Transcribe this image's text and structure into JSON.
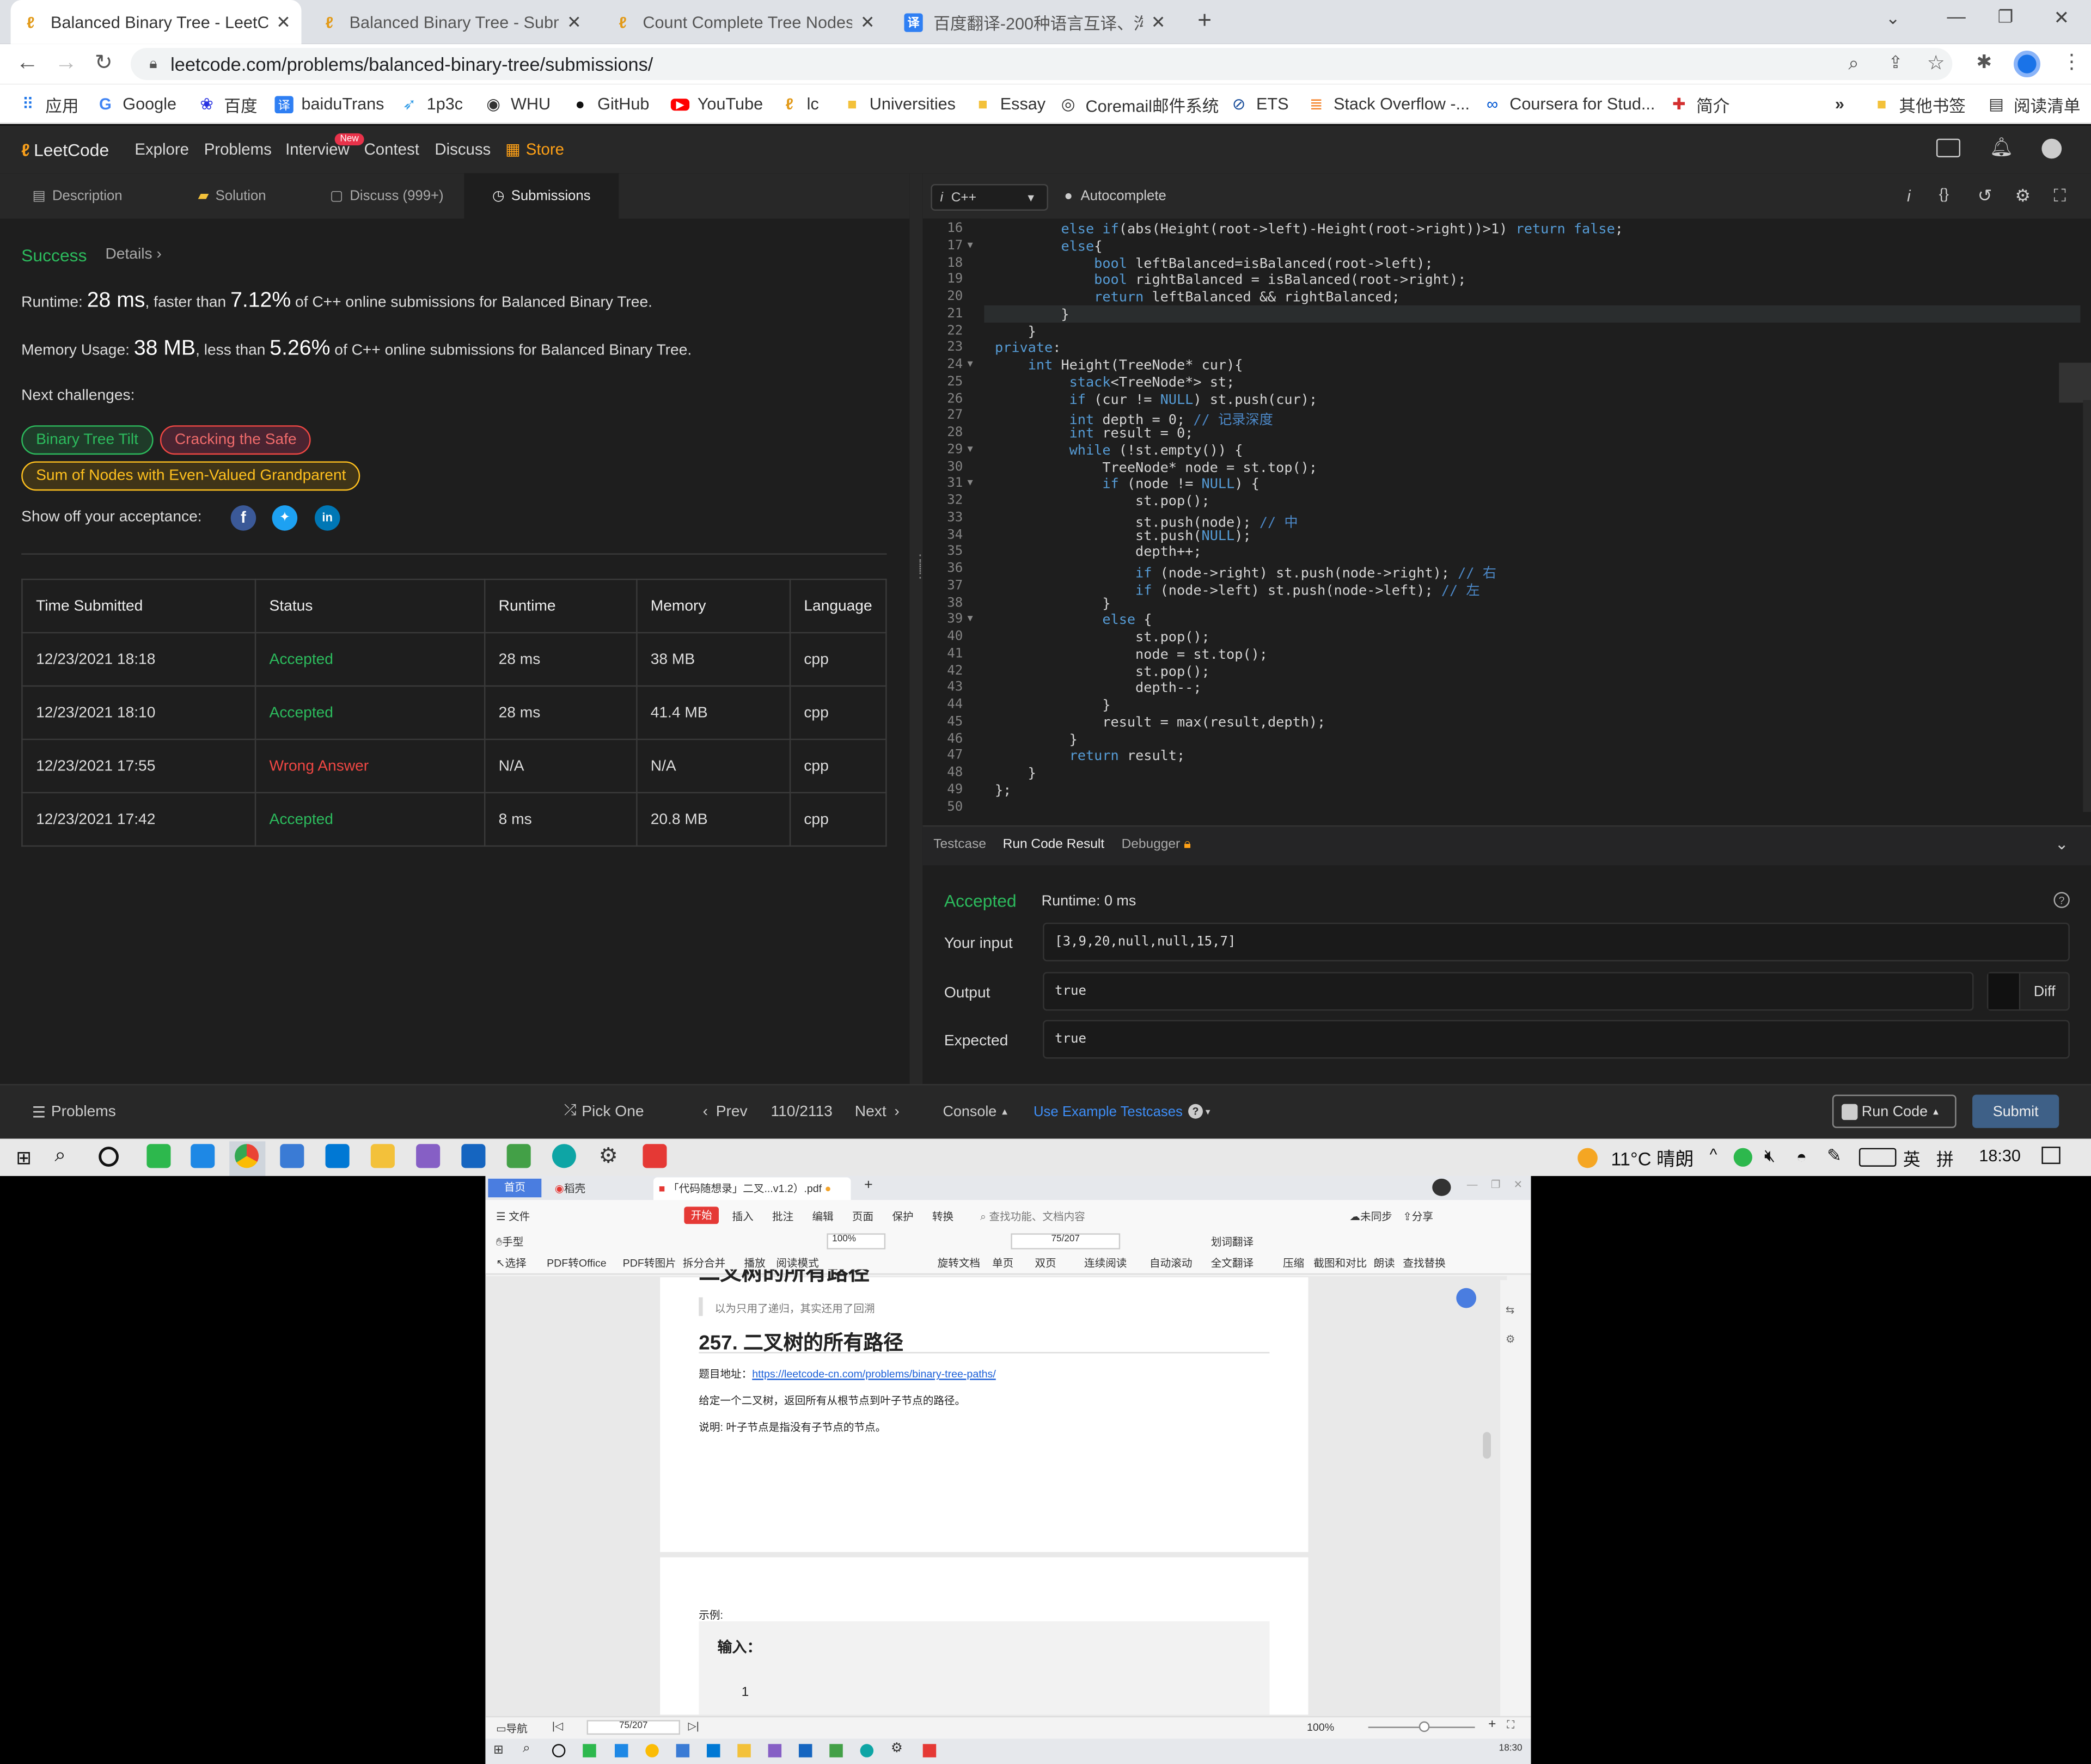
{
  "browser": {
    "tabs": [
      {
        "title": "Balanced Binary Tree - LeetCo",
        "icon": "leetcode-icon",
        "active": true
      },
      {
        "title": "Balanced Binary Tree - Submis",
        "icon": "leetcode-icon"
      },
      {
        "title": "Count Complete Tree Nodes -",
        "icon": "leetcode-icon"
      },
      {
        "title": "百度翻译-200种语言互译、沟通",
        "icon": "baidu-translate-icon"
      }
    ],
    "url": "leetcode.com/problems/balanced-binary-tree/submissions/",
    "bookmarks": [
      "应用",
      "Google",
      "百度",
      "baiduTrans",
      "1p3c",
      "WHU",
      "GitHub",
      "YouTube",
      "lc",
      "Universities",
      "Essay",
      "Coremail邮件系统",
      "ETS",
      "Stack Overflow -...",
      "Coursera for Stud...",
      "简介"
    ],
    "bookmarks_more": "»",
    "bookmarks_other": "其他书签",
    "reading_list": "阅读清单"
  },
  "lc_nav": {
    "logo": "LeetCode",
    "items": [
      "Explore",
      "Problems",
      "Interview",
      "Contest",
      "Discuss",
      "Store"
    ],
    "new_badge": "New"
  },
  "left_tabs": [
    "Description",
    "Solution",
    "Discuss (999+)",
    "Submissions"
  ],
  "result": {
    "status": "Success",
    "details": "Details",
    "runtime_label": "Runtime:",
    "runtime_value": "28 ms",
    "runtime_mid": ", faster than",
    "runtime_pct": "7.12%",
    "runtime_tail": "of C++ online submissions for Balanced Binary Tree.",
    "memory_label": "Memory Usage:",
    "memory_value": "38 MB",
    "memory_mid": ", less than",
    "memory_pct": "5.26%",
    "memory_tail": "of C++ online submissions for Balanced Binary Tree.",
    "next_label": "Next challenges:",
    "challenges": [
      "Binary Tree Tilt",
      "Cracking the Safe",
      "Sum of Nodes with Even-Valued Grandparent"
    ],
    "show_off": "Show off your acceptance:"
  },
  "submissions": {
    "headers": [
      "Time Submitted",
      "Status",
      "Runtime",
      "Memory",
      "Language"
    ],
    "rows": [
      [
        "12/23/2021 18:18",
        "Accepted",
        "28 ms",
        "38 MB",
        "cpp"
      ],
      [
        "12/23/2021 18:10",
        "Accepted",
        "28 ms",
        "41.4 MB",
        "cpp"
      ],
      [
        "12/23/2021 17:55",
        "Wrong Answer",
        "N/A",
        "N/A",
        "cpp"
      ],
      [
        "12/23/2021 17:42",
        "Accepted",
        "8 ms",
        "20.8 MB",
        "cpp"
      ]
    ]
  },
  "editor": {
    "language": "C++",
    "autocomplete": "Autocomplete",
    "lines": [
      {
        "n": "16",
        "t": "        else if(abs(Height(root->left)-Height(root->right))>1) return false;"
      },
      {
        "n": "17",
        "t": "        else{",
        "fold": true
      },
      {
        "n": "18",
        "t": "            bool leftBalanced=isBalanced(root->left);"
      },
      {
        "n": "19",
        "t": "            bool rightBalanced = isBalanced(root->right);"
      },
      {
        "n": "20",
        "t": "            return leftBalanced && rightBalanced;"
      },
      {
        "n": "21",
        "t": "        }"
      },
      {
        "n": "22",
        "t": "    }"
      },
      {
        "n": "23",
        "t": "private:"
      },
      {
        "n": "24",
        "t": "    int Height(TreeNode* cur){",
        "fold": true
      },
      {
        "n": "25",
        "t": "         stack<TreeNode*> st;"
      },
      {
        "n": "26",
        "t": "         if (cur != NULL) st.push(cur);"
      },
      {
        "n": "27",
        "t": "         int depth = 0; // 记录深度"
      },
      {
        "n": "28",
        "t": "         int result = 0;"
      },
      {
        "n": "29",
        "t": "         while (!st.empty()) {",
        "fold": true
      },
      {
        "n": "30",
        "t": "             TreeNode* node = st.top();"
      },
      {
        "n": "31",
        "t": "             if (node != NULL) {",
        "fold": true
      },
      {
        "n": "32",
        "t": "                 st.pop();"
      },
      {
        "n": "33",
        "t": "                 st.push(node); // 中"
      },
      {
        "n": "34",
        "t": "                 st.push(NULL);"
      },
      {
        "n": "35",
        "t": "                 depth++;"
      },
      {
        "n": "36",
        "t": "                 if (node->right) st.push(node->right); // 右"
      },
      {
        "n": "37",
        "t": "                 if (node->left) st.push(node->left); // 左"
      },
      {
        "n": "38",
        "t": "             }"
      },
      {
        "n": "39",
        "t": "             else {",
        "fold": true
      },
      {
        "n": "40",
        "t": "                 st.pop();"
      },
      {
        "n": "41",
        "t": "                 node = st.top();"
      },
      {
        "n": "42",
        "t": "                 st.pop();"
      },
      {
        "n": "43",
        "t": "                 depth--;"
      },
      {
        "n": "44",
        "t": "             }"
      },
      {
        "n": "45",
        "t": "             result = max(result,depth);"
      },
      {
        "n": "46",
        "t": "         }"
      },
      {
        "n": "47",
        "t": "         return result;"
      },
      {
        "n": "48",
        "t": "    }"
      },
      {
        "n": "49",
        "t": "};"
      },
      {
        "n": "50",
        "t": ""
      }
    ]
  },
  "run_result": {
    "tabs": [
      "Testcase",
      "Run Code Result",
      "Debugger"
    ],
    "status": "Accepted",
    "runtime": "Runtime: 0 ms",
    "input_label": "Your input",
    "input": "[3,9,20,null,null,15,7]",
    "output_label": "Output",
    "output": "true",
    "diff": "Diff",
    "expected_label": "Expected",
    "expected": "true"
  },
  "bottom_bar": {
    "problems": "Problems",
    "pick_one": "Pick One",
    "prev": "Prev",
    "page": "110/2113",
    "next": "Next",
    "console": "Console",
    "use_example": "Use Example Testcases",
    "run_code": "Run Code",
    "submit": "Submit"
  },
  "taskbar": {
    "weather": "11°C  晴朗",
    "ime": "英",
    "time": "18:30"
  },
  "wps": {
    "tabs": [
      "首页",
      "稻壳",
      "「代码随想录」二叉...v1.2）.pdf"
    ],
    "menu": [
      "文件",
      "开始",
      "插入",
      "批注",
      "编辑",
      "页面",
      "保护",
      "转换"
    ],
    "search": "查找功能、文档内容",
    "sync": "未同步",
    "share": "分享",
    "tools": [
      "手型",
      "选择",
      "PDF转Office",
      "PDF转图片",
      "拆分合并",
      "播放",
      "阅读模式",
      "旋转文档",
      "单页",
      "双页",
      "连续阅读",
      "自动滚动",
      "划词翻译",
      "全文翻译",
      "压缩",
      "截图和对比",
      "朗读",
      "查找替换"
    ],
    "zoom": "100%",
    "page": "75/207",
    "doc": {
      "prev_heading": "二叉树的所有路径",
      "quote": "以为只用了递归，其实还用了回溯",
      "heading": "257. 二叉树的所有路径",
      "addr_label": "题目地址：",
      "addr_link": "https://leetcode-cn.com/problems/binary-tree-paths/",
      "desc": "给定一个二叉树，返回所有从根节点到叶子节点的路径。",
      "note": "说明: 叶子节点是指没有子节点的节点。",
      "example_label": "示例:",
      "input_label": "输入：",
      "tree_root": "1"
    },
    "status_nav": "导航",
    "status_page": "75/207",
    "status_zoom": "100%",
    "inner_time": "18:30"
  }
}
